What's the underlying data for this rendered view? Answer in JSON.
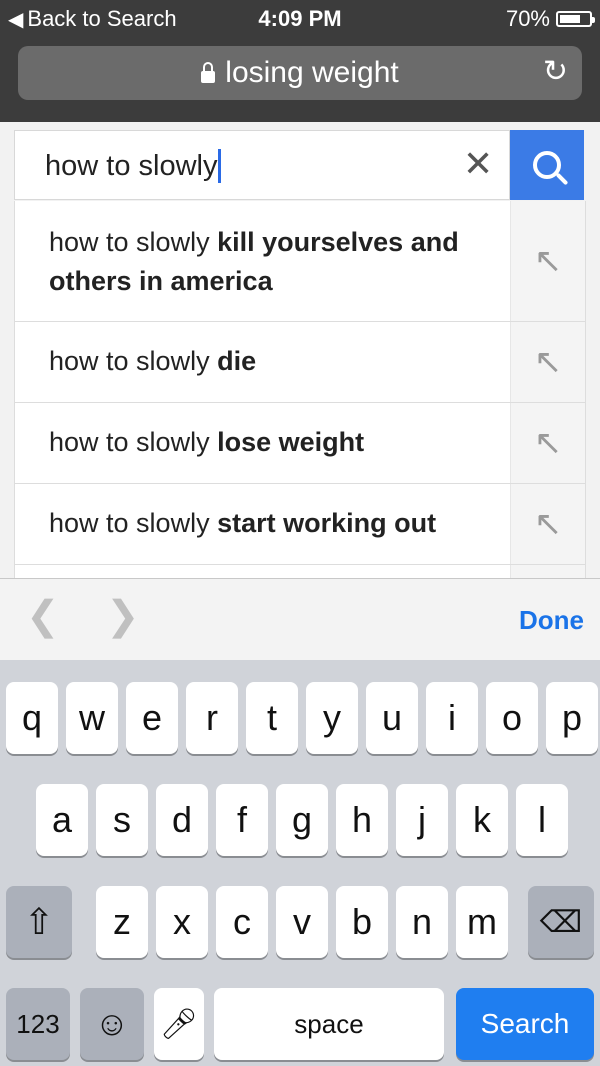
{
  "status_bar": {
    "back_label": "Back to Search",
    "time": "4:09 PM",
    "battery_percent": "70%",
    "battery_level": 0.7
  },
  "address_bar": {
    "text": "losing weight"
  },
  "search": {
    "query": "how to slowly"
  },
  "suggestions": [
    {
      "prefix": "how to slowly ",
      "suffix": "kill yourselves and others in america"
    },
    {
      "prefix": "how to slowly ",
      "suffix": "die"
    },
    {
      "prefix": "how to slowly ",
      "suffix": "lose weight"
    },
    {
      "prefix": "how to slowly ",
      "suffix": "start working out"
    }
  ],
  "accessory": {
    "done_label": "Done"
  },
  "keyboard": {
    "row1": [
      "q",
      "w",
      "e",
      "r",
      "t",
      "y",
      "u",
      "i",
      "o",
      "p"
    ],
    "row2": [
      "a",
      "s",
      "d",
      "f",
      "g",
      "h",
      "j",
      "k",
      "l"
    ],
    "row3": [
      "z",
      "x",
      "c",
      "v",
      "b",
      "n",
      "m"
    ],
    "numbers_label": "123",
    "space_label": "space",
    "search_label": "Search"
  },
  "colors": {
    "accent_blue": "#1f7ef0",
    "search_button": "#3b7be6"
  },
  "icons": [
    "back-arrow-icon",
    "lock-icon",
    "reload-icon",
    "clear-icon",
    "search-icon",
    "fill-suggestion-arrow-icon",
    "chevron-left-icon",
    "chevron-right-icon",
    "shift-icon",
    "delete-icon",
    "emoji-icon",
    "microphone-icon"
  ]
}
